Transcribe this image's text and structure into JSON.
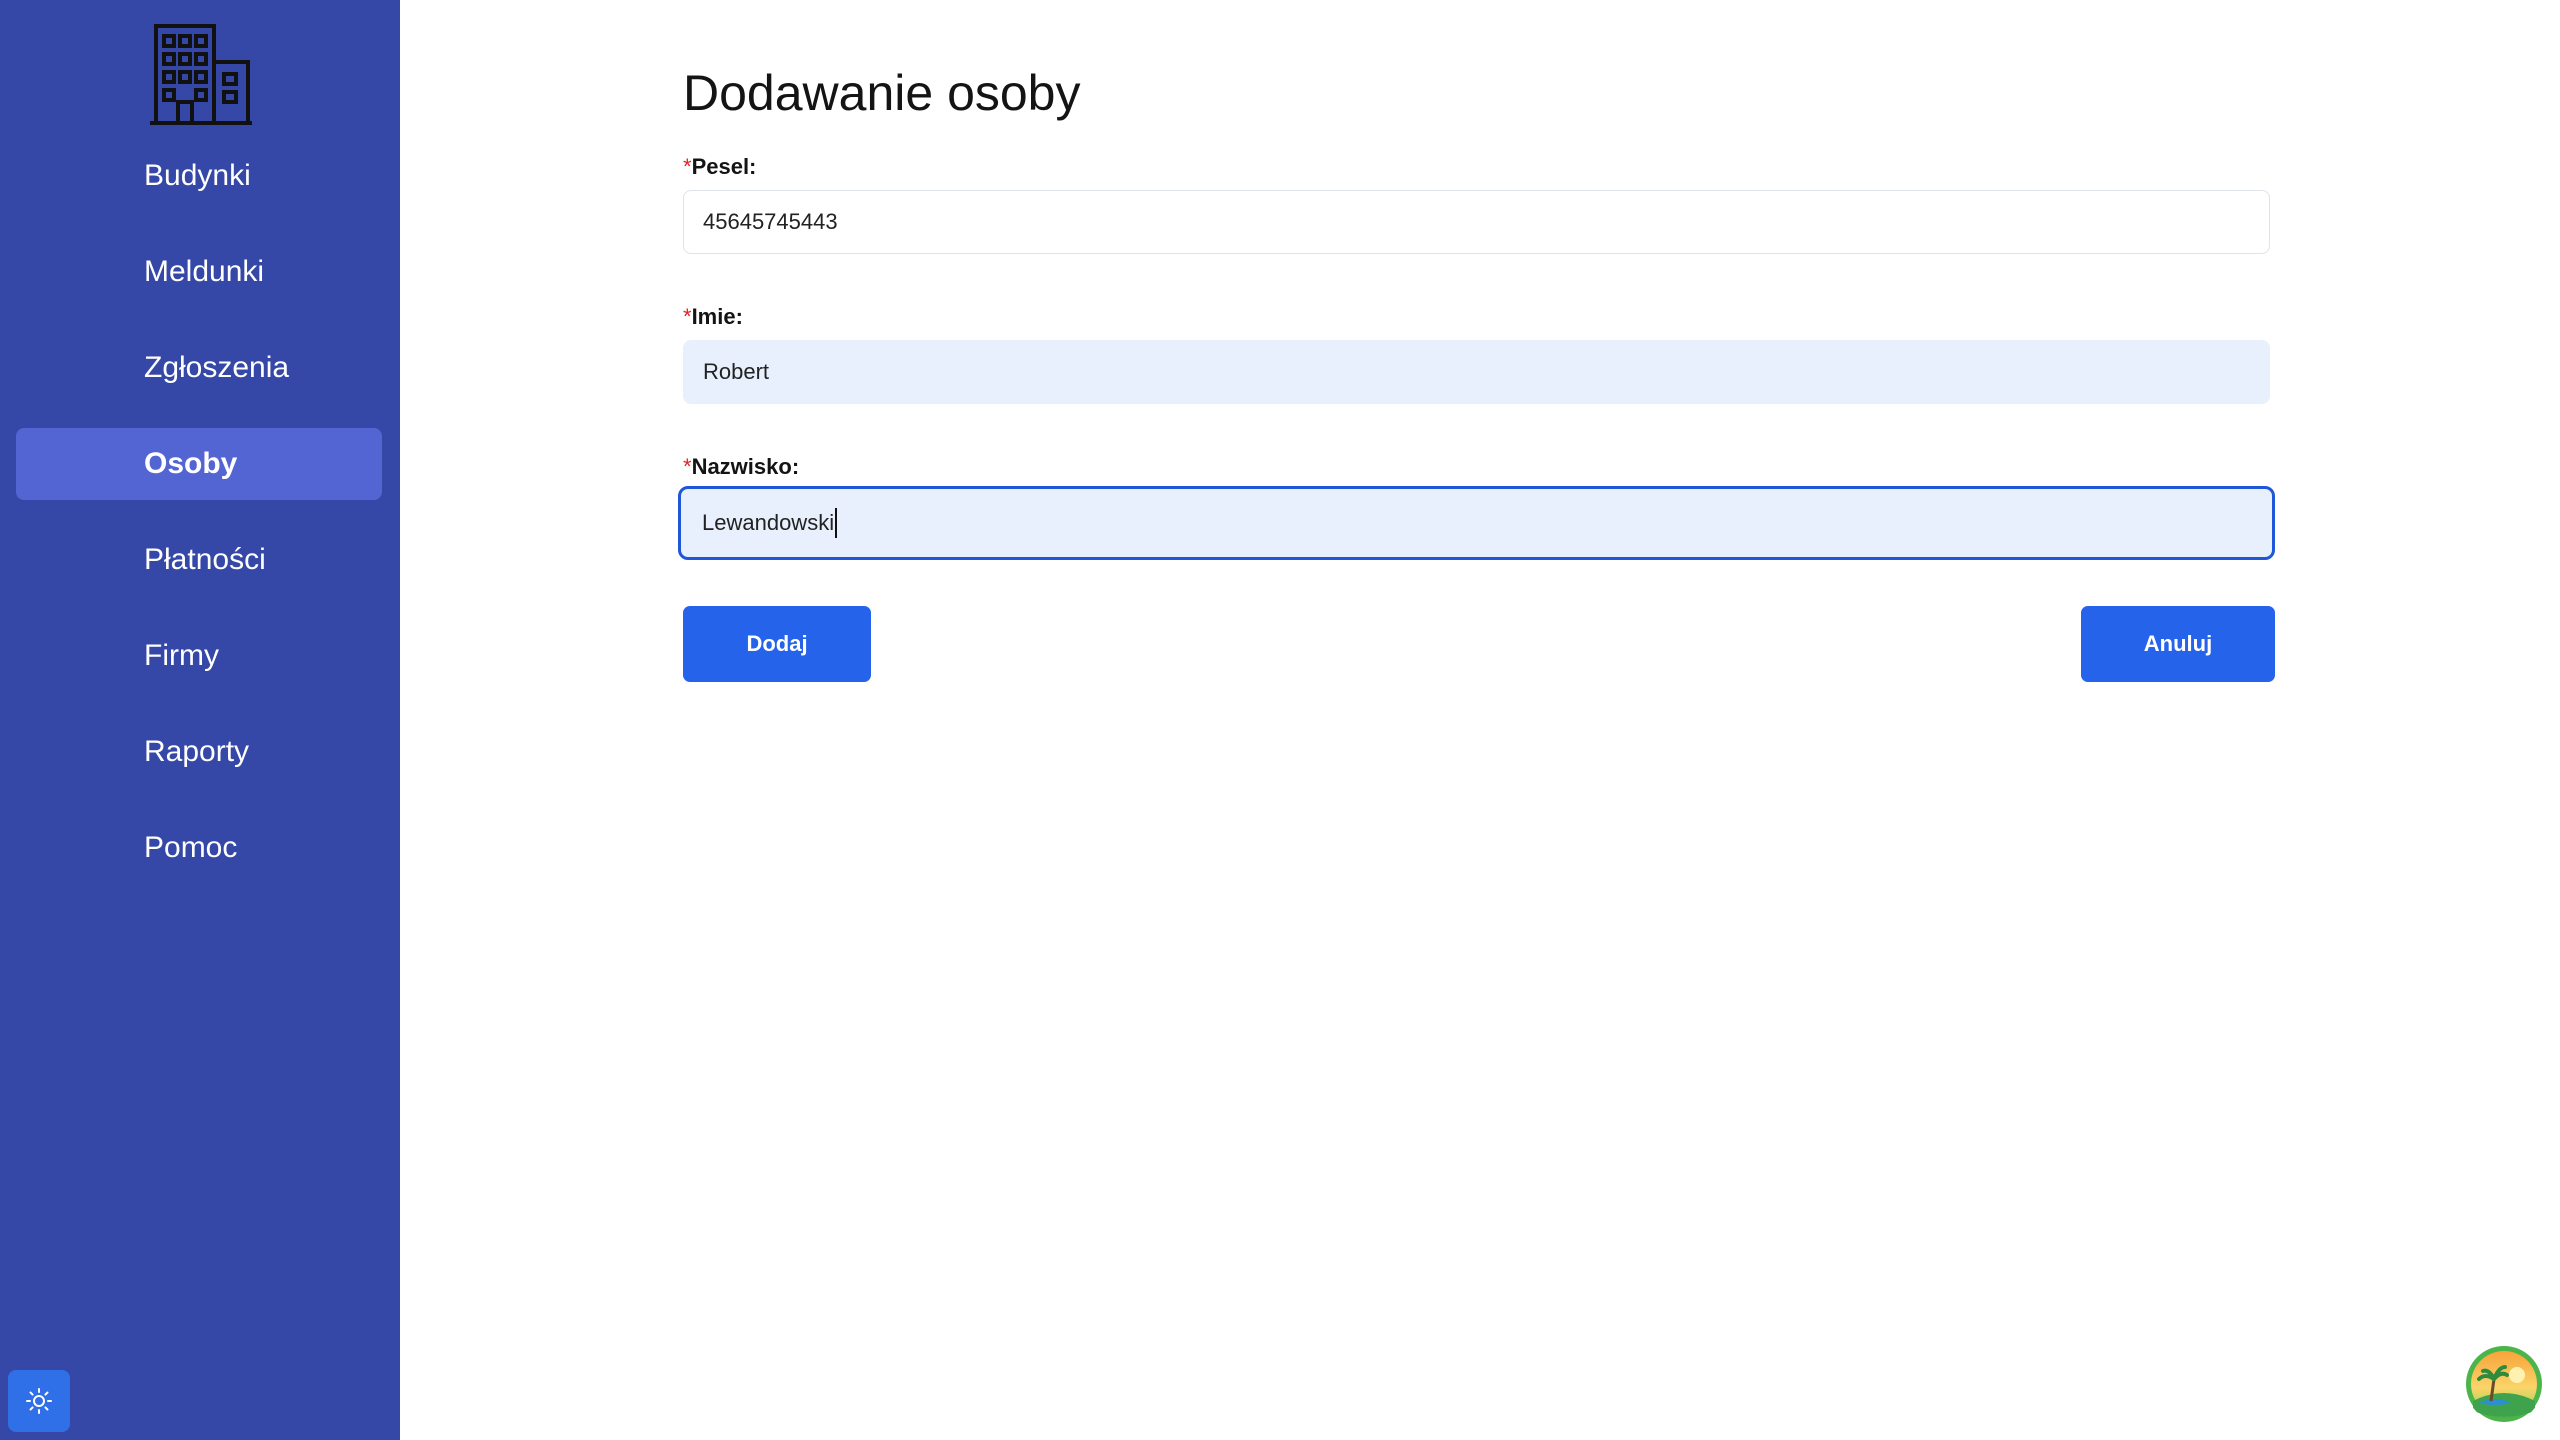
{
  "sidebar": {
    "logo_icon": "building-icon",
    "items": [
      {
        "label": "Budynki",
        "active": false
      },
      {
        "label": "Meldunki",
        "active": false
      },
      {
        "label": "Zgłoszenia",
        "active": false
      },
      {
        "label": "Osoby",
        "active": true
      },
      {
        "label": "Płatności",
        "active": false
      },
      {
        "label": "Firmy",
        "active": false
      },
      {
        "label": "Raporty",
        "active": false
      },
      {
        "label": "Pomoc",
        "active": false
      }
    ],
    "theme_icon": "sun-icon"
  },
  "form": {
    "title": "Dodawanie osoby",
    "required_marker": "*",
    "pesel": {
      "label": "Pesel:",
      "value": "45645745443"
    },
    "imie": {
      "label": "Imie:",
      "value": "Robert"
    },
    "nazwisko": {
      "label": "Nazwisko:",
      "value": "Lewandowski"
    },
    "submit_label": "Dodaj",
    "cancel_label": "Anuluj"
  },
  "colors": {
    "sidebar_bg": "#3548a8",
    "sidebar_active": "#5364d3",
    "accent": "#2563eb",
    "required": "#e02424"
  }
}
